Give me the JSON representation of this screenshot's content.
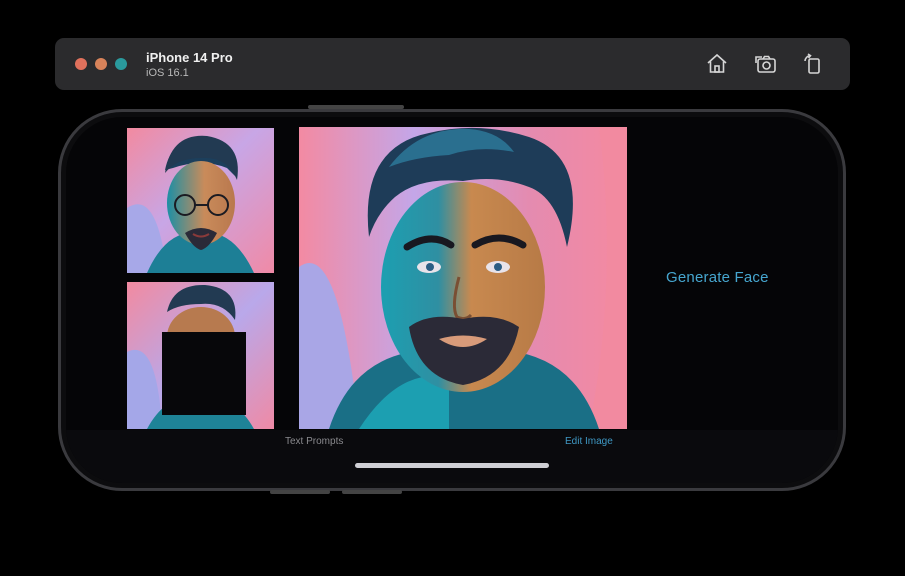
{
  "window": {
    "device_name": "iPhone 14 Pro",
    "os_version": "iOS 16.1",
    "traffic_lights": [
      "#e0715c",
      "#d8835a",
      "#2a9a9d"
    ],
    "toolbar_icons": [
      "home-icon",
      "screenshot-icon",
      "rotate-icon"
    ]
  },
  "app": {
    "generate_label": "Generate Face",
    "tabs": [
      {
        "label": "Text Prompts",
        "icon": "text-prompts-icon",
        "active": false
      },
      {
        "label": "Edit Image",
        "icon": "edit-image-icon",
        "active": true
      }
    ],
    "colors": {
      "accent": "#46a6cf",
      "pink": "#f28aa0",
      "lavender": "#a9a6e6",
      "teal": "#1c9fb1"
    }
  }
}
